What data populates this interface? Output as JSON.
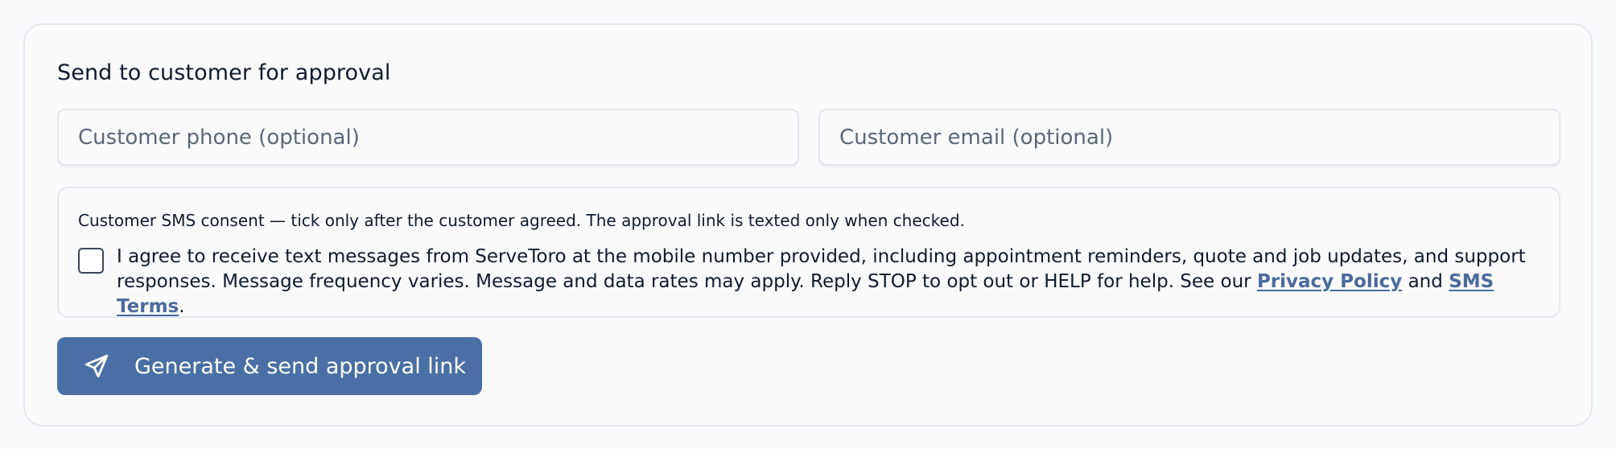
{
  "form": {
    "title": "Send to customer for approval",
    "phone_placeholder": "Customer phone (optional)",
    "email_placeholder": "Customer email (optional)"
  },
  "consent": {
    "note": "Customer SMS consent — tick only after the customer agreed. The approval link is texted only when checked.",
    "checked": false,
    "agree_text": "I agree to receive text messages from ServeToro at the mobile number provided, including appointment reminders, quote and job updates, and support responses. Message frequency varies. Message and data rates may apply. Reply STOP to opt out or HELP for help. See our",
    "privacy_link": "Privacy Policy",
    "and_text": "and",
    "sms_terms_link": "SMS Terms",
    "end_punct": "."
  },
  "actions": {
    "send_label": "Generate & send approval link",
    "send_icon": "paper-plane-icon"
  },
  "colors": {
    "accent": "#4a6fa5",
    "link": "#4a6a9b",
    "text": "#0f1b2d",
    "muted": "#5b6878",
    "border": "#e3e7f0"
  }
}
